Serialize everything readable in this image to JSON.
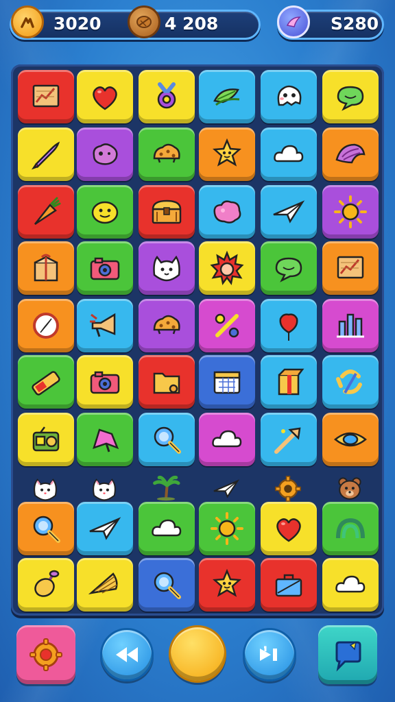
{
  "hud": {
    "score": "3020",
    "coins": "4  208",
    "gems": "S280"
  },
  "colors": {
    "red": "#e8322c",
    "yellow": "#f7e02a",
    "cyan": "#37b8ee",
    "orange": "#f7911f",
    "purple": "#a94fdc",
    "green": "#4bc53a",
    "blue": "#3b6fd8",
    "magenta": "#d64bcf",
    "pink": "#ef5a9a"
  },
  "board": {
    "rows": [
      [
        {
          "color": "red",
          "icon": "chart-icon"
        },
        {
          "color": "yellow",
          "icon": "heart-icon"
        },
        {
          "color": "yellow",
          "icon": "ring-icon"
        },
        {
          "color": "cyan",
          "icon": "leaf-icon"
        },
        {
          "color": "cyan",
          "icon": "ghost-icon"
        },
        {
          "color": "yellow",
          "icon": "chat-bubble-icon"
        }
      ],
      [
        {
          "color": "yellow",
          "icon": "rocket-icon"
        },
        {
          "color": "purple",
          "icon": "blob-icon"
        },
        {
          "color": "green",
          "icon": "cookie-icon"
        },
        {
          "color": "orange",
          "icon": "star-face-icon"
        },
        {
          "color": "cyan",
          "icon": "cloud-icon"
        },
        {
          "color": "orange",
          "icon": "shell-icon"
        }
      ],
      [
        {
          "color": "red",
          "icon": "carrot-icon"
        },
        {
          "color": "green",
          "icon": "smiley-icon"
        },
        {
          "color": "red",
          "icon": "treasure-chest-icon"
        },
        {
          "color": "cyan",
          "icon": "splat-icon"
        },
        {
          "color": "cyan",
          "icon": "paper-plane-icon"
        },
        {
          "color": "purple",
          "icon": "sun-icon"
        }
      ],
      [
        {
          "color": "orange",
          "icon": "gift-box-icon"
        },
        {
          "color": "green",
          "icon": "camera-icon"
        },
        {
          "color": "purple",
          "icon": "cat-face-icon"
        },
        {
          "color": "yellow",
          "icon": "spiky-face-icon"
        },
        {
          "color": "green",
          "icon": "chat-bubble-icon"
        },
        {
          "color": "orange",
          "icon": "chart-icon"
        }
      ],
      [
        {
          "color": "orange",
          "icon": "compass-icon"
        },
        {
          "color": "cyan",
          "icon": "megaphone-icon"
        },
        {
          "color": "purple",
          "icon": "cookie-icon"
        },
        {
          "color": "magenta",
          "icon": "percent-icon"
        },
        {
          "color": "cyan",
          "icon": "balloon-icon"
        },
        {
          "color": "magenta",
          "icon": "bar-chart-icon"
        }
      ],
      [
        {
          "color": "green",
          "icon": "battery-icon"
        },
        {
          "color": "yellow",
          "icon": "camera-icon"
        },
        {
          "color": "red",
          "icon": "folder-icon"
        },
        {
          "color": "blue",
          "icon": "calendar-icon"
        },
        {
          "color": "cyan",
          "icon": "package-icon"
        },
        {
          "color": "cyan",
          "icon": "recycle-icon"
        }
      ],
      [
        {
          "color": "yellow",
          "icon": "radio-icon"
        },
        {
          "color": "green",
          "icon": "pink-star-icon"
        },
        {
          "color": "cyan",
          "icon": "magnifier-icon"
        },
        {
          "color": "magenta",
          "icon": "cloud-icon"
        },
        {
          "color": "cyan",
          "icon": "arrow-icon"
        },
        {
          "color": "orange",
          "icon": "eye-icon"
        }
      ],
      [
        {
          "color": "none",
          "icon": "cat-critter-icon"
        },
        {
          "color": "none",
          "icon": "cat-critter-icon"
        },
        {
          "color": "none",
          "icon": "palm-tree-icon"
        },
        {
          "color": "none",
          "icon": "paper-plane-icon"
        },
        {
          "color": "none",
          "icon": "gear-icon"
        },
        {
          "color": "none",
          "icon": "bear-critter-icon"
        }
      ],
      [
        {
          "color": "orange",
          "icon": "magnifier-icon"
        },
        {
          "color": "cyan",
          "icon": "paper-plane-icon"
        },
        {
          "color": "green",
          "icon": "cloud-icon"
        },
        {
          "color": "green",
          "icon": "sun-icon"
        },
        {
          "color": "yellow",
          "icon": "heart-icon"
        },
        {
          "color": "green",
          "icon": "rainbow-icon"
        }
      ],
      [
        {
          "color": "yellow",
          "icon": "lemon-icon"
        },
        {
          "color": "yellow",
          "icon": "fan-icon"
        },
        {
          "color": "blue",
          "icon": "magnifier-icon"
        },
        {
          "color": "red",
          "icon": "star-face-icon"
        },
        {
          "color": "red",
          "icon": "briefcase-icon"
        },
        {
          "color": "yellow",
          "icon": "cloud-icon"
        }
      ]
    ]
  },
  "controls": [
    {
      "name": "settings-button",
      "icon": "gear-icon"
    },
    {
      "name": "rewind-button",
      "icon": "rewind-icon"
    },
    {
      "name": "play-button",
      "icon": "circle-icon"
    },
    {
      "name": "skip-button",
      "icon": "skip-icon"
    },
    {
      "name": "chat-button",
      "icon": "chat-bubble-icon"
    }
  ]
}
